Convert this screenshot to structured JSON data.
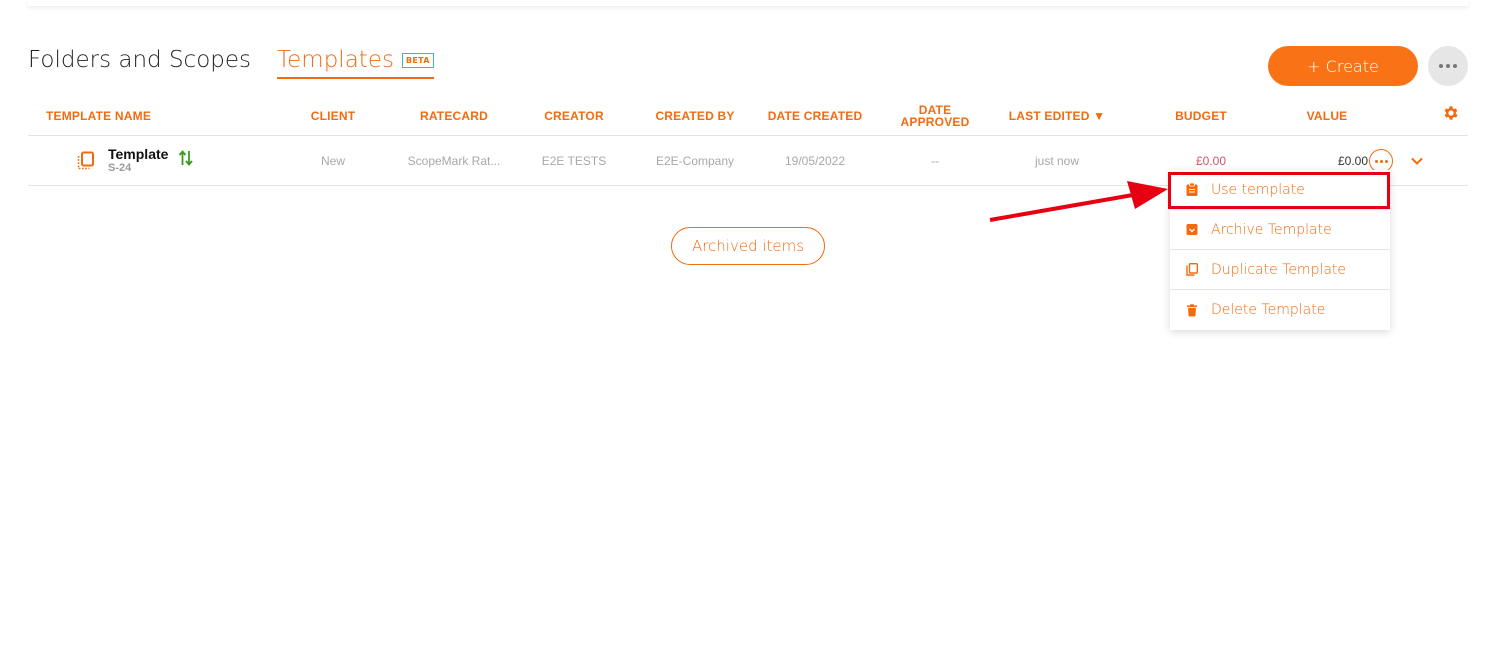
{
  "tabs": {
    "folders_label": "Folders and Scopes",
    "templates_label": "Templates",
    "beta_badge": "BETA"
  },
  "toolbar": {
    "create_label": "+ Create",
    "more_icon": "more-horizontal-icon"
  },
  "table": {
    "columns": {
      "template_name": "TEMPLATE NAME",
      "client": "CLIENT",
      "ratecard": "RATECARD",
      "creator": "CREATOR",
      "created_by": "CREATED BY",
      "date_created": "DATE CREATED",
      "date_approved_line1": "DATE",
      "date_approved_line2": "APPROVED",
      "last_edited": "LAST EDITED ▼",
      "budget": "BUDGET",
      "value": "VALUE"
    },
    "rows": [
      {
        "name": "Template",
        "id": "S-24",
        "client": "New",
        "ratecard": "ScopeMark Rat...",
        "creator": "E2E TESTS",
        "created_by": "E2E-Company",
        "date_created": "19/05/2022",
        "date_approved": "--",
        "last_edited": "just now",
        "budget": "£0.00",
        "value": "£0.00"
      }
    ]
  },
  "archived_label": "Archived items",
  "row_menu": {
    "items": [
      {
        "label": "Use template",
        "icon": "clipboard-icon"
      },
      {
        "label": "Archive Template",
        "icon": "archive-icon"
      },
      {
        "label": "Duplicate Template",
        "icon": "copy-icon"
      },
      {
        "label": "Delete Template",
        "icon": "trash-icon"
      }
    ]
  },
  "colors": {
    "accent": "#f26b0f",
    "create_button": "#f97316",
    "budget_text": "#d4546b",
    "highlight": "#e60012",
    "sort_icon": "#3a9a1e"
  }
}
